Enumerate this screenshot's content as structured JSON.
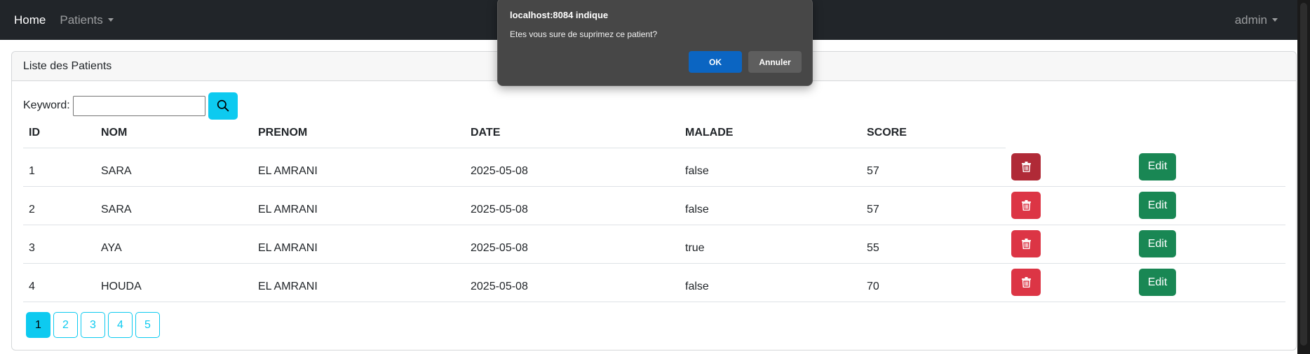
{
  "navbar": {
    "home": "Home",
    "patients": "Patients",
    "user": "admin"
  },
  "card": {
    "title": "Liste des Patients"
  },
  "search": {
    "label": "Keyword:",
    "value": "",
    "placeholder": "",
    "button_icon": "search-icon"
  },
  "table": {
    "headers": [
      "ID",
      "NOM",
      "PRENOM",
      "DATE",
      "MALADE",
      "SCORE"
    ],
    "rows": [
      {
        "id": "1",
        "nom": "SARA",
        "prenom": "EL AMRANI",
        "date": "2025-05-08",
        "malade": "false",
        "score": "57"
      },
      {
        "id": "2",
        "nom": "SARA",
        "prenom": "EL AMRANI",
        "date": "2025-05-08",
        "malade": "false",
        "score": "57"
      },
      {
        "id": "3",
        "nom": "AYA",
        "prenom": "EL AMRANI",
        "date": "2025-05-08",
        "malade": "true",
        "score": "55"
      },
      {
        "id": "4",
        "nom": "HOUDA",
        "prenom": "EL AMRANI",
        "date": "2025-05-08",
        "malade": "false",
        "score": "70"
      }
    ],
    "delete_icon": "trash-icon",
    "edit_label": "Edit"
  },
  "pagination": {
    "pages": [
      "1",
      "2",
      "3",
      "4",
      "5"
    ],
    "current": "1"
  },
  "dialog": {
    "title": "localhost:8084 indique",
    "message": "Etes vous sure de suprimez ce patient?",
    "ok_label": "OK",
    "cancel_label": "Annuler"
  },
  "colors": {
    "navbar_bg": "#212529",
    "info": "#0dcaf0",
    "danger": "#dc3545",
    "danger_active": "#b02a37",
    "success": "#198754",
    "dialog_bg": "#474747",
    "dialog_ok": "#0b65c2"
  }
}
